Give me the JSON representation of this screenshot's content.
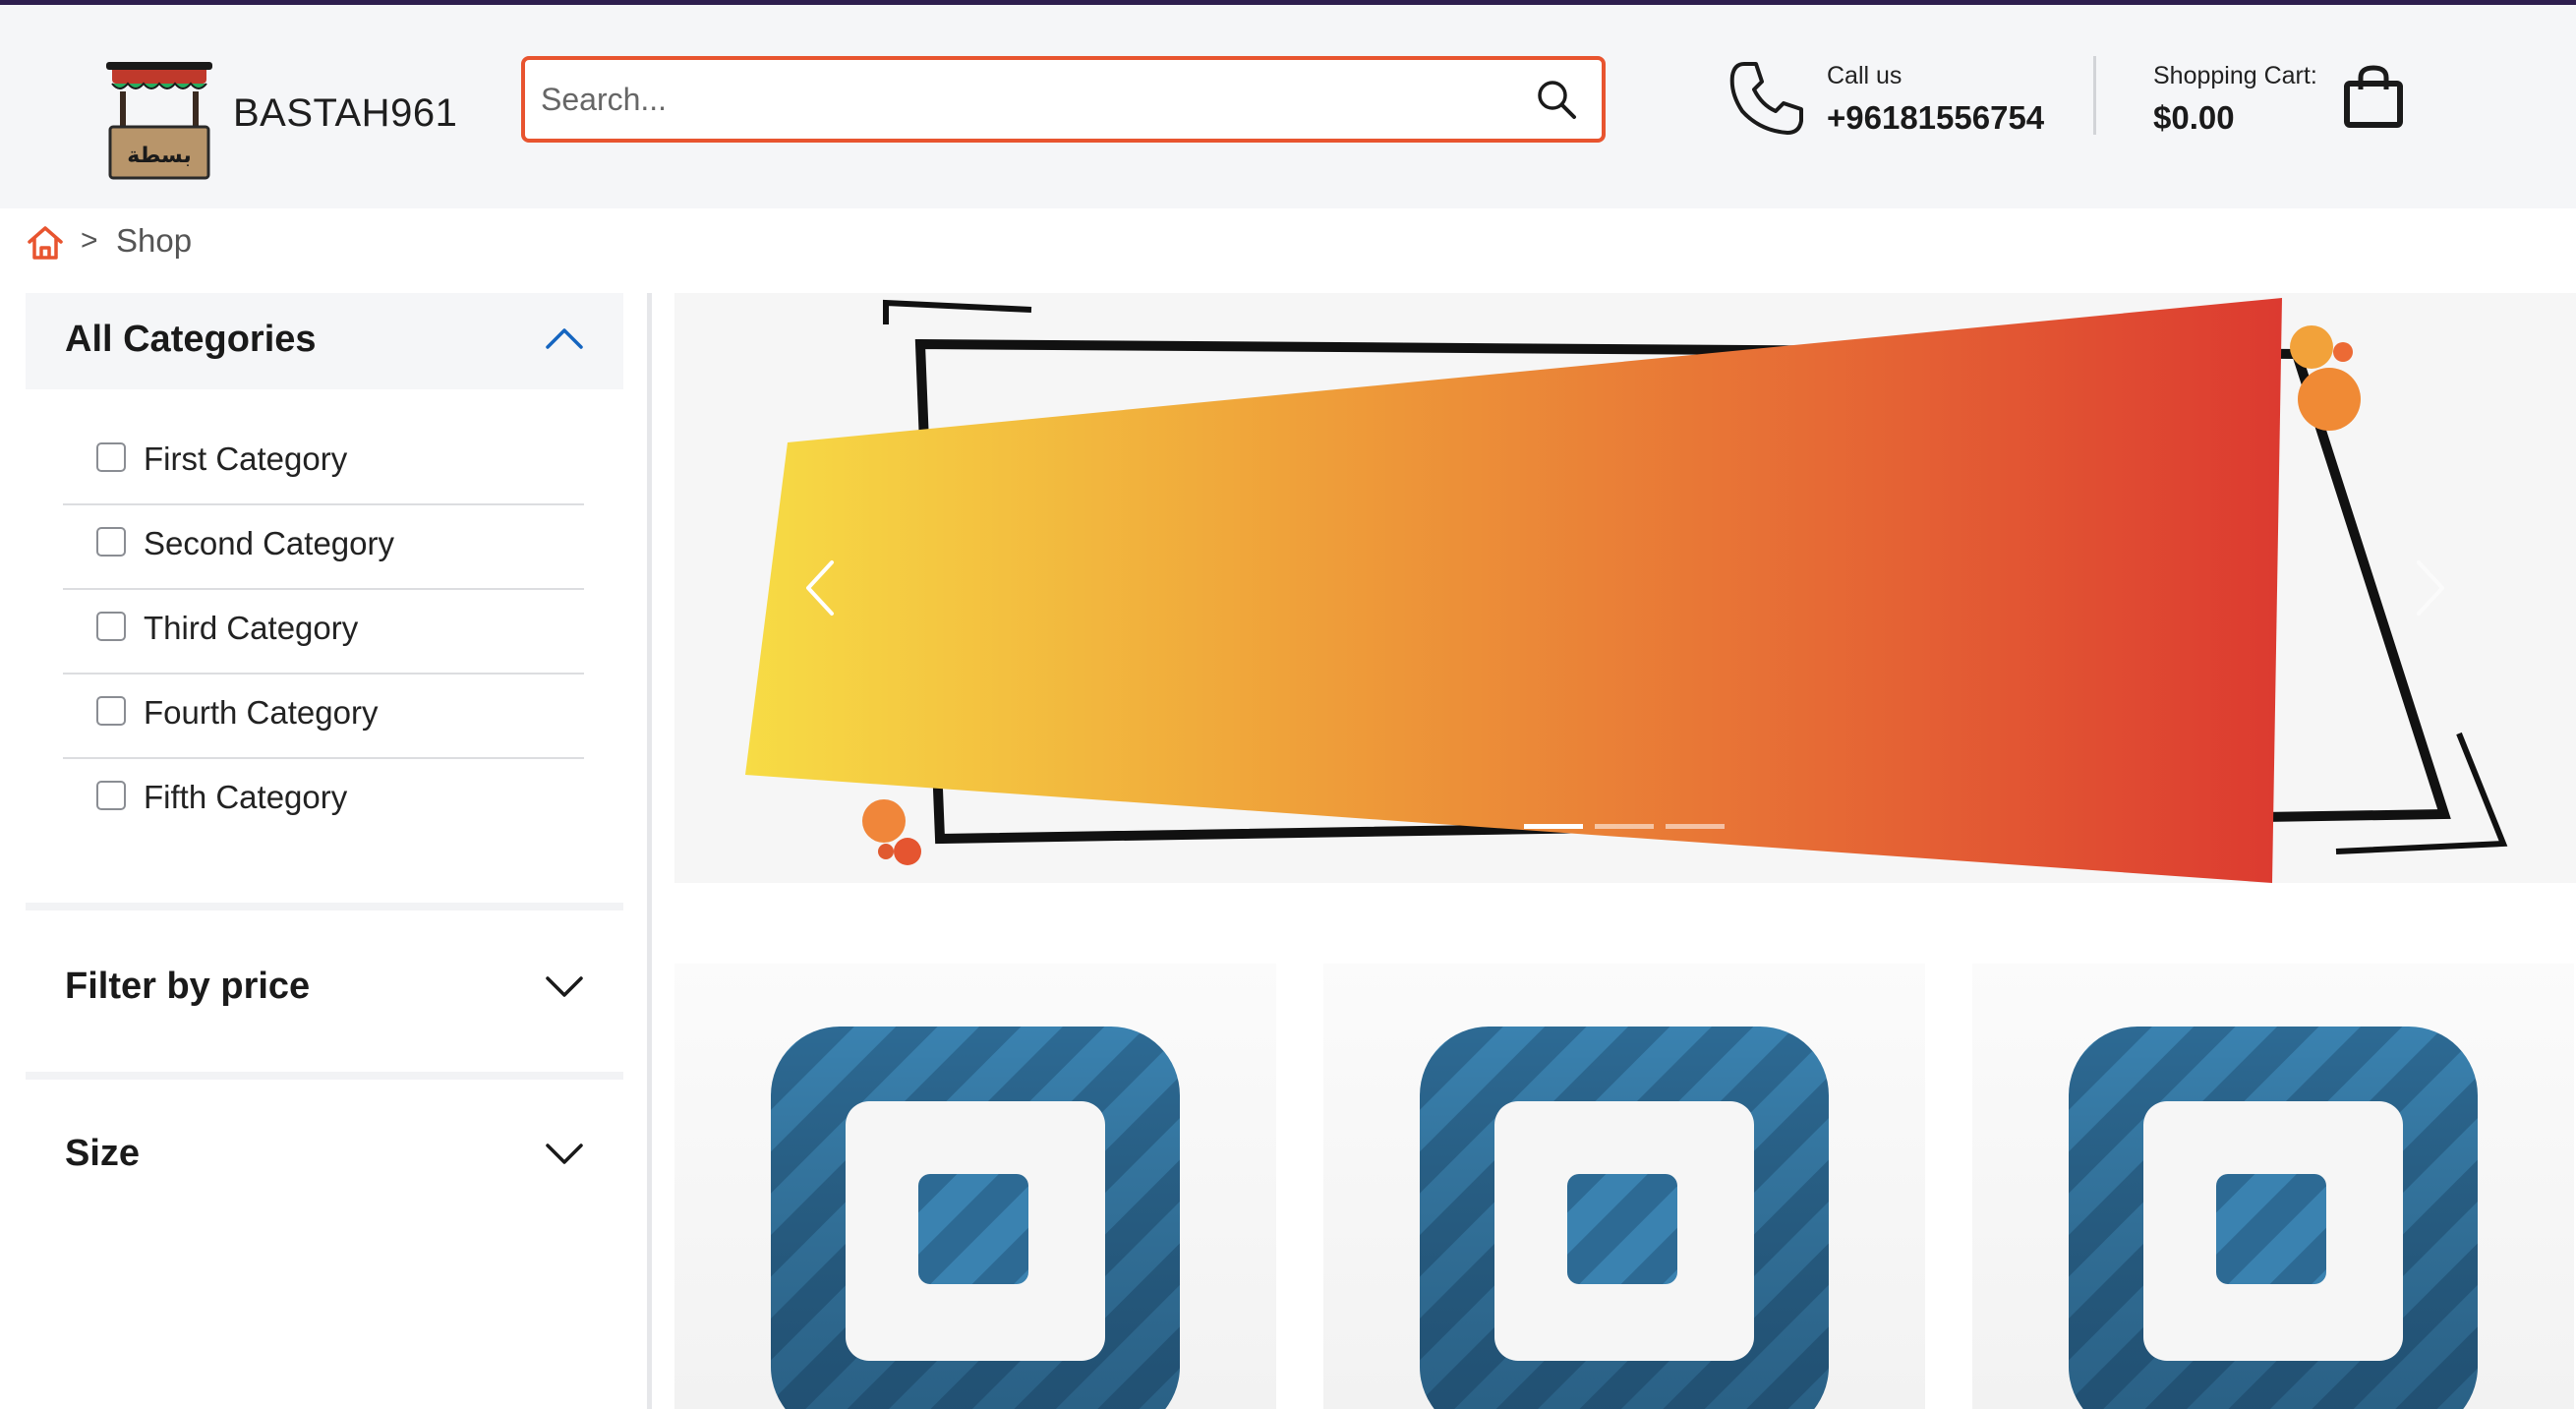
{
  "header": {
    "brand_name": "BASTAH961",
    "logo_text": "بسطة",
    "search_placeholder": "Search...",
    "call_label": "Call us",
    "call_number": "+96181556754",
    "cart_label": "Shopping Cart:",
    "cart_total": "$0.00"
  },
  "breadcrumb": {
    "separator": ">",
    "current": "Shop"
  },
  "sidebar": {
    "categories_title": "All Categories",
    "categories": [
      {
        "label": "First Category",
        "checked": false
      },
      {
        "label": "Second Category",
        "checked": false
      },
      {
        "label": "Third Category",
        "checked": false
      },
      {
        "label": "Fourth Category",
        "checked": false
      },
      {
        "label": "Fifth Category",
        "checked": false
      }
    ],
    "price_title": "Filter by price",
    "size_title": "Size"
  },
  "banner": {
    "slide_count": 3,
    "active_slide": 1
  },
  "products": [
    {
      "image": "placeholder-square-icon"
    },
    {
      "image": "placeholder-square-icon"
    },
    {
      "image": "placeholder-square-icon"
    }
  ],
  "colors": {
    "accent": "#e8542f",
    "topline": "#2e1f4f",
    "header_bg": "#f5f6f8",
    "placeholder_blue": "#2f6f99"
  }
}
